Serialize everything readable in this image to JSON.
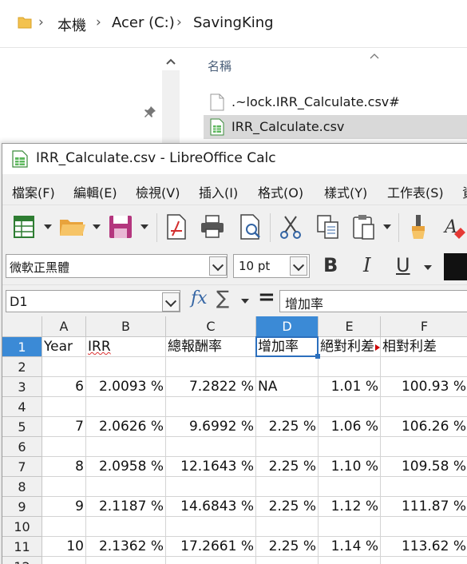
{
  "explorer": {
    "breadcrumb": [
      "本機",
      "Acer (C:)",
      "SavingKing"
    ],
    "column_name": "名稱",
    "files": [
      {
        "name": ".~lock.IRR_Calculate.csv#",
        "selected": false,
        "icon": "file-icon"
      },
      {
        "name": "IRR_Calculate.csv",
        "selected": true,
        "icon": "spreadsheet-icon"
      }
    ]
  },
  "calc": {
    "title": "IRR_Calculate.csv - LibreOffice Calc",
    "menu": [
      "檔案(F)",
      "編輯(E)",
      "檢視(V)",
      "插入(I)",
      "格式(O)",
      "樣式(Y)",
      "工作表(S)",
      "資"
    ],
    "toolbar_icons": [
      "new-spreadsheet-icon",
      "open-folder-icon",
      "save-icon",
      "export-pdf-icon",
      "print-icon",
      "print-preview-icon",
      "cut-icon",
      "copy-icon",
      "paste-icon",
      "clone-format-icon",
      "clear-format-icon"
    ],
    "font_name": "微軟正黑體",
    "font_size": "10 pt",
    "format_buttons": {
      "bold": "B",
      "italic": "I",
      "underline": "U"
    },
    "name_box": "D1",
    "fx": "fx",
    "sigma": "∑",
    "equals": "=",
    "formula_input": "增加率",
    "columns": [
      "A",
      "B",
      "C",
      "D",
      "E",
      "F"
    ],
    "active_column": "D",
    "active_row": "1",
    "rows": [
      {
        "num": "1",
        "cells": [
          "Year",
          "IRR",
          "總報酬率",
          "增加率",
          "絕對利差",
          "相對利差"
        ]
      },
      {
        "num": "2",
        "cells": [
          "",
          "",
          "",
          "",
          "",
          ""
        ]
      },
      {
        "num": "3",
        "cells": [
          "6",
          "2.0093 %",
          "7.2822 %",
          "NA",
          "1.01 %",
          "100.93 %"
        ]
      },
      {
        "num": "4",
        "cells": [
          "",
          "",
          "",
          "",
          "",
          ""
        ]
      },
      {
        "num": "5",
        "cells": [
          "7",
          "2.0626 %",
          "9.6992 %",
          "2.25 %",
          "1.06 %",
          "106.26 %"
        ]
      },
      {
        "num": "6",
        "cells": [
          "",
          "",
          "",
          "",
          "",
          ""
        ]
      },
      {
        "num": "7",
        "cells": [
          "8",
          "2.0958 %",
          "12.1643 %",
          "2.25 %",
          "1.10 %",
          "109.58 %"
        ]
      },
      {
        "num": "8",
        "cells": [
          "",
          "",
          "",
          "",
          "",
          ""
        ]
      },
      {
        "num": "9",
        "cells": [
          "9",
          "2.1187 %",
          "14.6843 %",
          "2.25 %",
          "1.12 %",
          "111.87 %"
        ]
      },
      {
        "num": "10",
        "cells": [
          "",
          "",
          "",
          "",
          "",
          ""
        ]
      },
      {
        "num": "11",
        "cells": [
          "10",
          "2.1362 %",
          "17.2661 %",
          "2.25 %",
          "1.14 %",
          "113.62 %"
        ]
      },
      {
        "num": "12",
        "cells": [
          "",
          "",
          "",
          "",
          "",
          ""
        ]
      }
    ],
    "accent_color": "#3b8ad6"
  }
}
